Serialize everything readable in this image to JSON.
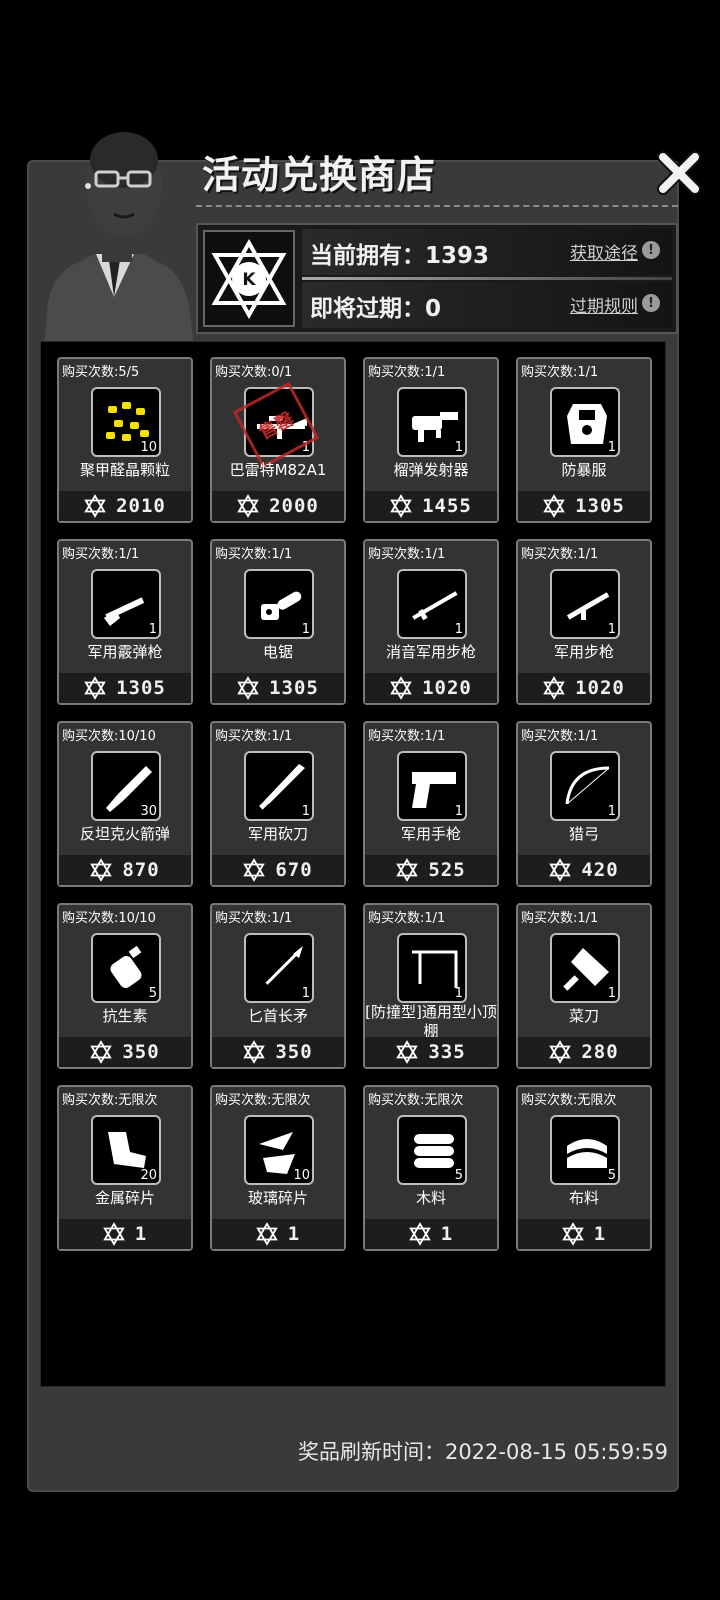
{
  "shop": {
    "title": "活动兑换商店",
    "owned_label": "当前拥有：",
    "owned_value": "1393",
    "expire_label": "即将过期：",
    "expire_value": "0",
    "get_route_link": "获取途径",
    "expire_rule_link": "过期规则",
    "info_icon_glyph": "!",
    "token_letter": "K",
    "stamp_text": "售罄",
    "refresh_label": "奖品刷新时间：",
    "refresh_time": "2022-08-15 05:59:59"
  },
  "colors": {
    "panel": "#3a3a3a",
    "card": "#333333",
    "card_border": "#7a7a7a",
    "stamp": "#c02828"
  },
  "items": [
    {
      "limit": "购买次数:5/5",
      "name": "聚甲醛晶颗粒",
      "qty": "10",
      "price": "2010",
      "icon": "crystal-granules-icon",
      "sold_out": false
    },
    {
      "limit": "购买次数:0/1",
      "name": "巴雷特M82A1",
      "qty": "1",
      "price": "2000",
      "icon": "sniper-rifle-icon",
      "sold_out": true
    },
    {
      "limit": "购买次数:1/1",
      "name": "榴弹发射器",
      "qty": "1",
      "price": "1455",
      "icon": "grenade-launcher-icon",
      "sold_out": false
    },
    {
      "limit": "购买次数:1/1",
      "name": "防暴服",
      "qty": "1",
      "price": "1305",
      "icon": "riot-armor-icon",
      "sold_out": false
    },
    {
      "limit": "购买次数:1/1",
      "name": "军用霰弹枪",
      "qty": "1",
      "price": "1305",
      "icon": "shotgun-icon",
      "sold_out": false
    },
    {
      "limit": "购买次数:1/1",
      "name": "电锯",
      "qty": "1",
      "price": "1305",
      "icon": "chainsaw-icon",
      "sold_out": false
    },
    {
      "limit": "购买次数:1/1",
      "name": "消音军用步枪",
      "qty": "1",
      "price": "1020",
      "icon": "silenced-rifle-icon",
      "sold_out": false
    },
    {
      "limit": "购买次数:1/1",
      "name": "军用步枪",
      "qty": "1",
      "price": "1020",
      "icon": "assault-rifle-icon",
      "sold_out": false
    },
    {
      "limit": "购买次数:10/10",
      "name": "反坦克火箭弹",
      "qty": "30",
      "price": "870",
      "icon": "rocket-icon",
      "sold_out": false
    },
    {
      "limit": "购买次数:1/1",
      "name": "军用砍刀",
      "qty": "1",
      "price": "670",
      "icon": "machete-icon",
      "sold_out": false
    },
    {
      "limit": "购买次数:1/1",
      "name": "军用手枪",
      "qty": "1",
      "price": "525",
      "icon": "pistol-icon",
      "sold_out": false
    },
    {
      "limit": "购买次数:1/1",
      "name": "猎弓",
      "qty": "1",
      "price": "420",
      "icon": "bow-icon",
      "sold_out": false
    },
    {
      "limit": "购买次数:10/10",
      "name": "抗生素",
      "qty": "5",
      "price": "350",
      "icon": "antibiotic-icon",
      "sold_out": false
    },
    {
      "limit": "购买次数:1/1",
      "name": "匕首长矛",
      "qty": "1",
      "price": "350",
      "icon": "spear-icon",
      "sold_out": false
    },
    {
      "limit": "购买次数:1/1",
      "name": "[防撞型]通用型小顶棚",
      "qty": "1",
      "price": "335",
      "icon": "canopy-icon",
      "sold_out": false
    },
    {
      "limit": "购买次数:1/1",
      "name": "菜刀",
      "qty": "1",
      "price": "280",
      "icon": "cleaver-icon",
      "sold_out": false
    },
    {
      "limit": "购买次数:无限次",
      "name": "金属碎片",
      "qty": "20",
      "price": "1",
      "icon": "metal-scrap-icon",
      "sold_out": false
    },
    {
      "limit": "购买次数:无限次",
      "name": "玻璃碎片",
      "qty": "10",
      "price": "1",
      "icon": "glass-shard-icon",
      "sold_out": false
    },
    {
      "limit": "购买次数:无限次",
      "name": "木料",
      "qty": "5",
      "price": "1",
      "icon": "wood-icon",
      "sold_out": false
    },
    {
      "limit": "购买次数:无限次",
      "name": "布料",
      "qty": "5",
      "price": "1",
      "icon": "cloth-icon",
      "sold_out": false
    }
  ]
}
